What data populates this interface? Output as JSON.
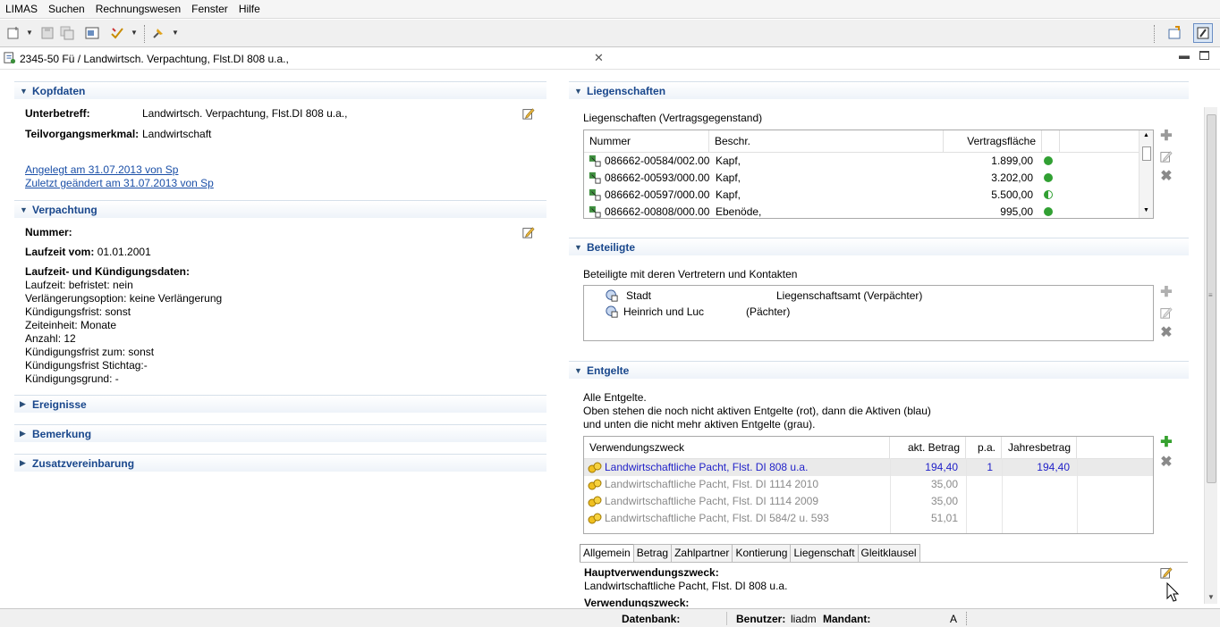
{
  "menu": [
    "LIMAS",
    "Suchen",
    "Rechnungswesen",
    "Fenster",
    "Hilfe"
  ],
  "tab": {
    "title": "2345-50 Fü          / Landwirtsch. Verpachtung, Flst.DI 808 u.a.,"
  },
  "kopfdaten": {
    "title": "Kopfdaten",
    "unterbetreff_label": "Unterbetreff:",
    "unterbetreff_value": "Landwirtsch. Verpachtung, Flst.DI 808 u.a.,",
    "teilvorgang_label": "Teilvorgangsmerkmal:",
    "teilvorgang_value": "Landwirtschaft",
    "angelegt": "Angelegt am 31.07.2013 von Sp",
    "geaendert": "Zuletzt geändert am 31.07.2013 von Sp"
  },
  "verpachtung": {
    "title": "Verpachtung",
    "nummer_label": "Nummer:",
    "laufzeit_label": "Laufzeit vom:",
    "laufzeit_value": "01.01.2001",
    "kd_label": "Laufzeit- und Kündigungsdaten:",
    "lines": [
      "Laufzeit: befristet: nein",
      "Verlängerungsoption: keine Verlängerung",
      "Kündigungsfrist: sonst",
      "Zeiteinheit: Monate",
      "Anzahl: 12",
      "Kündigungsfrist zum: sonst",
      "Kündigungsfrist Stichtag:-",
      "Kündigungsgrund: -"
    ]
  },
  "collapsed_sections": [
    "Ereignisse",
    "Bemerkung",
    "Zusatzvereinbarung"
  ],
  "liegenschaften": {
    "title": "Liegenschaften",
    "subtitle": "Liegenschaften (Vertragsgegenstand)",
    "columns": [
      "Nummer",
      "Beschr.",
      "Vertragsfläche"
    ],
    "rows": [
      {
        "nummer": "086662-00584/002.00",
        "beschr": "Kapf,",
        "flaeche": "1.899,00",
        "status": "full"
      },
      {
        "nummer": "086662-00593/000.00",
        "beschr": "Kapf,",
        "flaeche": "3.202,00",
        "status": "full"
      },
      {
        "nummer": "086662-00597/000.00",
        "beschr": "Kapf,",
        "flaeche": "5.500,00",
        "status": "half"
      },
      {
        "nummer": "086662-00808/000.00",
        "beschr": "Ebenöde,",
        "flaeche": "995,00",
        "status": "full"
      }
    ]
  },
  "beteiligte": {
    "title": "Beteiligte",
    "subtitle": "Beteiligte mit deren Vertretern und Kontakten",
    "rows": [
      {
        "name": "Stadt",
        "role": "Liegenschaftsamt (Verpächter)"
      },
      {
        "name": "Heinrich und Luc",
        "role": "(Pächter)"
      }
    ]
  },
  "entgelte": {
    "title": "Entgelte",
    "desc": [
      "Alle Entgelte.",
      "Oben stehen die noch nicht aktiven Entgelte (rot), dann die Aktiven (blau)",
      "und unten die nicht mehr aktiven Entgelte (grau)."
    ],
    "columns": [
      "Verwendungszweck",
      "akt. Betrag",
      "p.a.",
      "Jahresbetrag"
    ],
    "rows": [
      {
        "zweck": "Landwirtschaftliche Pacht, Flst. DI 808 u.a.",
        "betrag": "194,40",
        "pa": "1",
        "jahr": "194,40",
        "state": "active"
      },
      {
        "zweck": "Landwirtschaftliche Pacht, Flst. DI 1114 2010",
        "betrag": "35,00",
        "pa": "",
        "jahr": "",
        "state": "old"
      },
      {
        "zweck": "Landwirtschaftliche Pacht, Flst. DI 1114 2009",
        "betrag": "35,00",
        "pa": "",
        "jahr": "",
        "state": "old"
      },
      {
        "zweck": "Landwirtschaftliche Pacht, Flst. DI 584/2 u. 593",
        "betrag": "51,01",
        "pa": "",
        "jahr": "",
        "state": "old"
      }
    ],
    "subtabs": [
      "Allgemein",
      "Betrag",
      "Zahlpartner",
      "Kontierung",
      "Liegenschaft",
      "Gleitklausel"
    ],
    "haupt_label": "Hauptverwendungszweck:",
    "haupt_value": "Landwirtschaftliche Pacht, Flst. DI 808 u.a.",
    "verwendung_label": "Verwendungszweck:"
  },
  "status": {
    "datenbank_label": "Datenbank:",
    "benutzer_label": "Benutzer:",
    "benutzer_value": "liadm",
    "mandant_label": "Mandant:",
    "mandant_value": "A"
  },
  "colors": {
    "accent": "#19478c",
    "active_row": "#1f1fc8",
    "inactive_row": "#8a8a8a",
    "status_green": "#31a033"
  }
}
